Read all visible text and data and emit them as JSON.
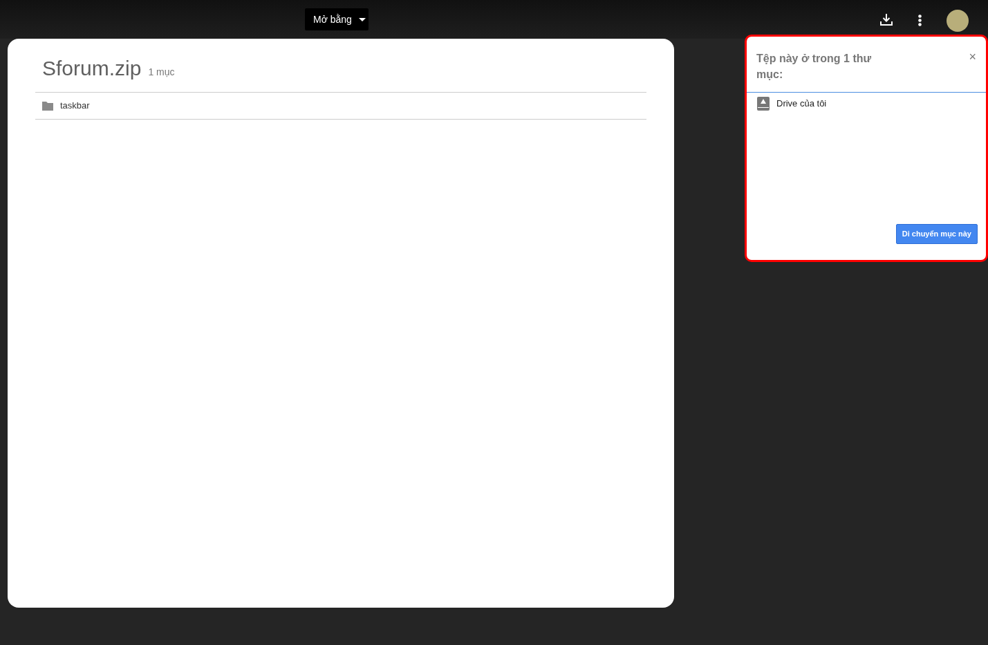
{
  "toolbar": {
    "open_with": "Mở bằng"
  },
  "archive": {
    "title": "Sforum.zip",
    "count": "1 mục",
    "items": [
      {
        "name": "taskbar"
      }
    ]
  },
  "popup": {
    "title": "Tệp này ở trong 1 thư mục:",
    "close": "×",
    "locations": [
      {
        "name": "Drive của tôi"
      }
    ],
    "button": "Di chuyển mục này"
  }
}
